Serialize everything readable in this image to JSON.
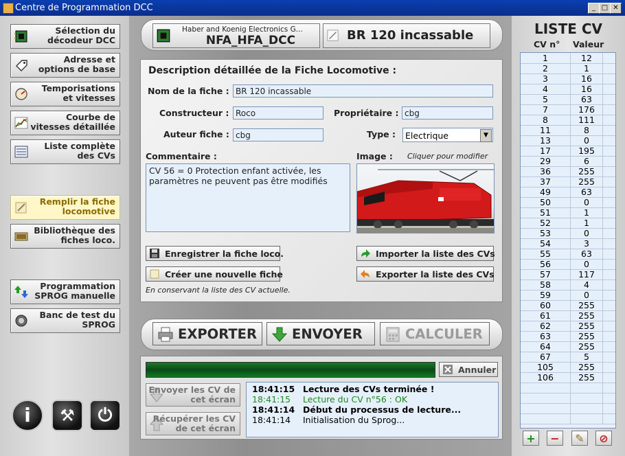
{
  "window": {
    "title": "Centre de Programmation DCC",
    "minimize": "_",
    "maximize": "□",
    "close": "✕"
  },
  "nav": {
    "items": [
      {
        "label": "Sélection du décodeur DCC",
        "icon": "decoder-chip-icon"
      },
      {
        "label": "Adresse et options de base",
        "icon": "tag-icon"
      },
      {
        "label": "Temporisations et vitesses",
        "icon": "speedometer-icon"
      },
      {
        "label": "Courbe de vitesses détaillée",
        "icon": "curve-chart-icon"
      },
      {
        "label": "Liste complète des CVs",
        "icon": "list-icon"
      },
      {
        "label": "Remplir la fiche locomotive",
        "icon": "pencil-icon",
        "active": true
      },
      {
        "label": "Bibliothèque des fiches loco.",
        "icon": "library-icon"
      },
      {
        "label": "Programmation SPROG manuelle",
        "icon": "up-down-arrows-icon"
      },
      {
        "label": "Banc de test du SPROG",
        "icon": "gauge-icon"
      }
    ],
    "bottom_icons": [
      "info-icon",
      "tools-icon",
      "power-icon"
    ],
    "bottom_glyphs": {
      "info": "i",
      "tools": "⚒",
      "power": "⏻"
    }
  },
  "header": {
    "manufacturer": "Haber and Koenig Electronics G...",
    "decoder_model": "NFA_HFA_DCC",
    "loco_name": "BR 120 incassable"
  },
  "sheet": {
    "title": "Description détaillée de la Fiche Locomotive :",
    "name_label": "Nom de la fiche :",
    "name_value": "BR 120 incassable",
    "builder_label": "Constructeur :",
    "builder_value": "Roco",
    "owner_label": "Propriétaire :",
    "owner_value": "cbg",
    "author_label": "Auteur fiche :",
    "author_value": "cbg",
    "type_label": "Type :",
    "type_value": "Electrique",
    "comment_label": "Commentaire :",
    "comment_value": "CV 56 = 0 Protection enfant activée, les paramètres ne peuvent pas être modifiés",
    "image_label": "Image :",
    "image_hint": "Cliquer pour modifier",
    "save_button": "Enregistrer la fiche loco.",
    "new_button": "Créer une nouvelle fiche",
    "import_button": "Importer la liste des CVs",
    "export_button": "Exporter la liste des CVs",
    "keep_note": "En conservant la liste des CV actuelle."
  },
  "actions": {
    "export": "EXPORTER",
    "send": "ENVOYER",
    "compute": "CALCULER"
  },
  "log": {
    "progress": 1.0,
    "cancel": "Annuler",
    "send_screen": "Envoyer les CV de cet écran",
    "fetch_screen": "Récupérer les CV de cet écran",
    "lines": [
      {
        "time": "18:41:15",
        "text": "Lecture des CVs terminée !",
        "style": "bold"
      },
      {
        "time": "18:41:15",
        "text": "Lecture du CV n°56 : OK",
        "style": "green"
      },
      {
        "time": "18:41:14",
        "text": "Début du processus de lecture...",
        "style": "bold"
      },
      {
        "time": "18:41:14",
        "text": "Initialisation du Sprog...",
        "style": "normal"
      }
    ]
  },
  "cv_list": {
    "title": "LISTE CV",
    "col_num": "CV n°",
    "col_val": "Valeur",
    "rows": [
      [
        "1",
        "12"
      ],
      [
        "2",
        "1"
      ],
      [
        "3",
        "16"
      ],
      [
        "4",
        "16"
      ],
      [
        "5",
        "63"
      ],
      [
        "7",
        "176"
      ],
      [
        "8",
        "111"
      ],
      [
        "11",
        "8"
      ],
      [
        "13",
        "0"
      ],
      [
        "17",
        "195"
      ],
      [
        "29",
        "6"
      ],
      [
        "36",
        "255"
      ],
      [
        "37",
        "255"
      ],
      [
        "49",
        "63"
      ],
      [
        "50",
        "0"
      ],
      [
        "51",
        "1"
      ],
      [
        "52",
        "1"
      ],
      [
        "53",
        "0"
      ],
      [
        "54",
        "3"
      ],
      [
        "55",
        "63"
      ],
      [
        "56",
        "0"
      ],
      [
        "57",
        "117"
      ],
      [
        "58",
        "4"
      ],
      [
        "59",
        "0"
      ],
      [
        "60",
        "255"
      ],
      [
        "61",
        "255"
      ],
      [
        "62",
        "255"
      ],
      [
        "63",
        "255"
      ],
      [
        "64",
        "255"
      ],
      [
        "67",
        "5"
      ],
      [
        "105",
        "255"
      ],
      [
        "106",
        "255"
      ]
    ],
    "buttons": {
      "add": "+",
      "remove": "−",
      "edit": "✎",
      "delete": "⊘"
    }
  }
}
